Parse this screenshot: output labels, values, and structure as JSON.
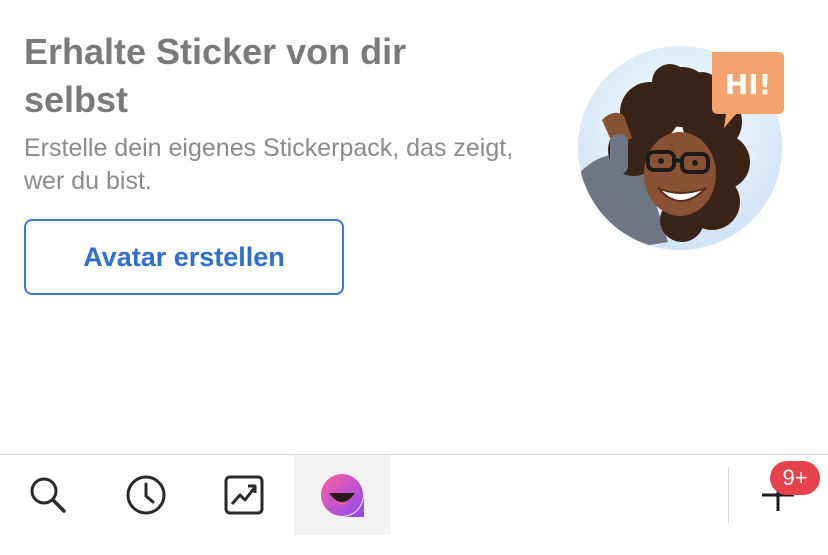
{
  "promo": {
    "title": "Erhalte Sticker von dir selbst",
    "description": "Erstelle dein eigenes Stickerpack, das zeigt, wer du bist.",
    "button_label": "Avatar erstellen",
    "bubble_text": "HI!"
  },
  "tabbar": {
    "tabs": [
      {
        "icon": "search-icon"
      },
      {
        "icon": "clock-icon"
      },
      {
        "icon": "trending-icon"
      },
      {
        "icon": "avatar-stickers-icon",
        "active": true
      }
    ],
    "add_icon": "plus-icon",
    "badge_count": "9+"
  },
  "colors": {
    "accent": "#3b78d3",
    "badge": "#e5424d",
    "title": "#7a7a7a"
  }
}
